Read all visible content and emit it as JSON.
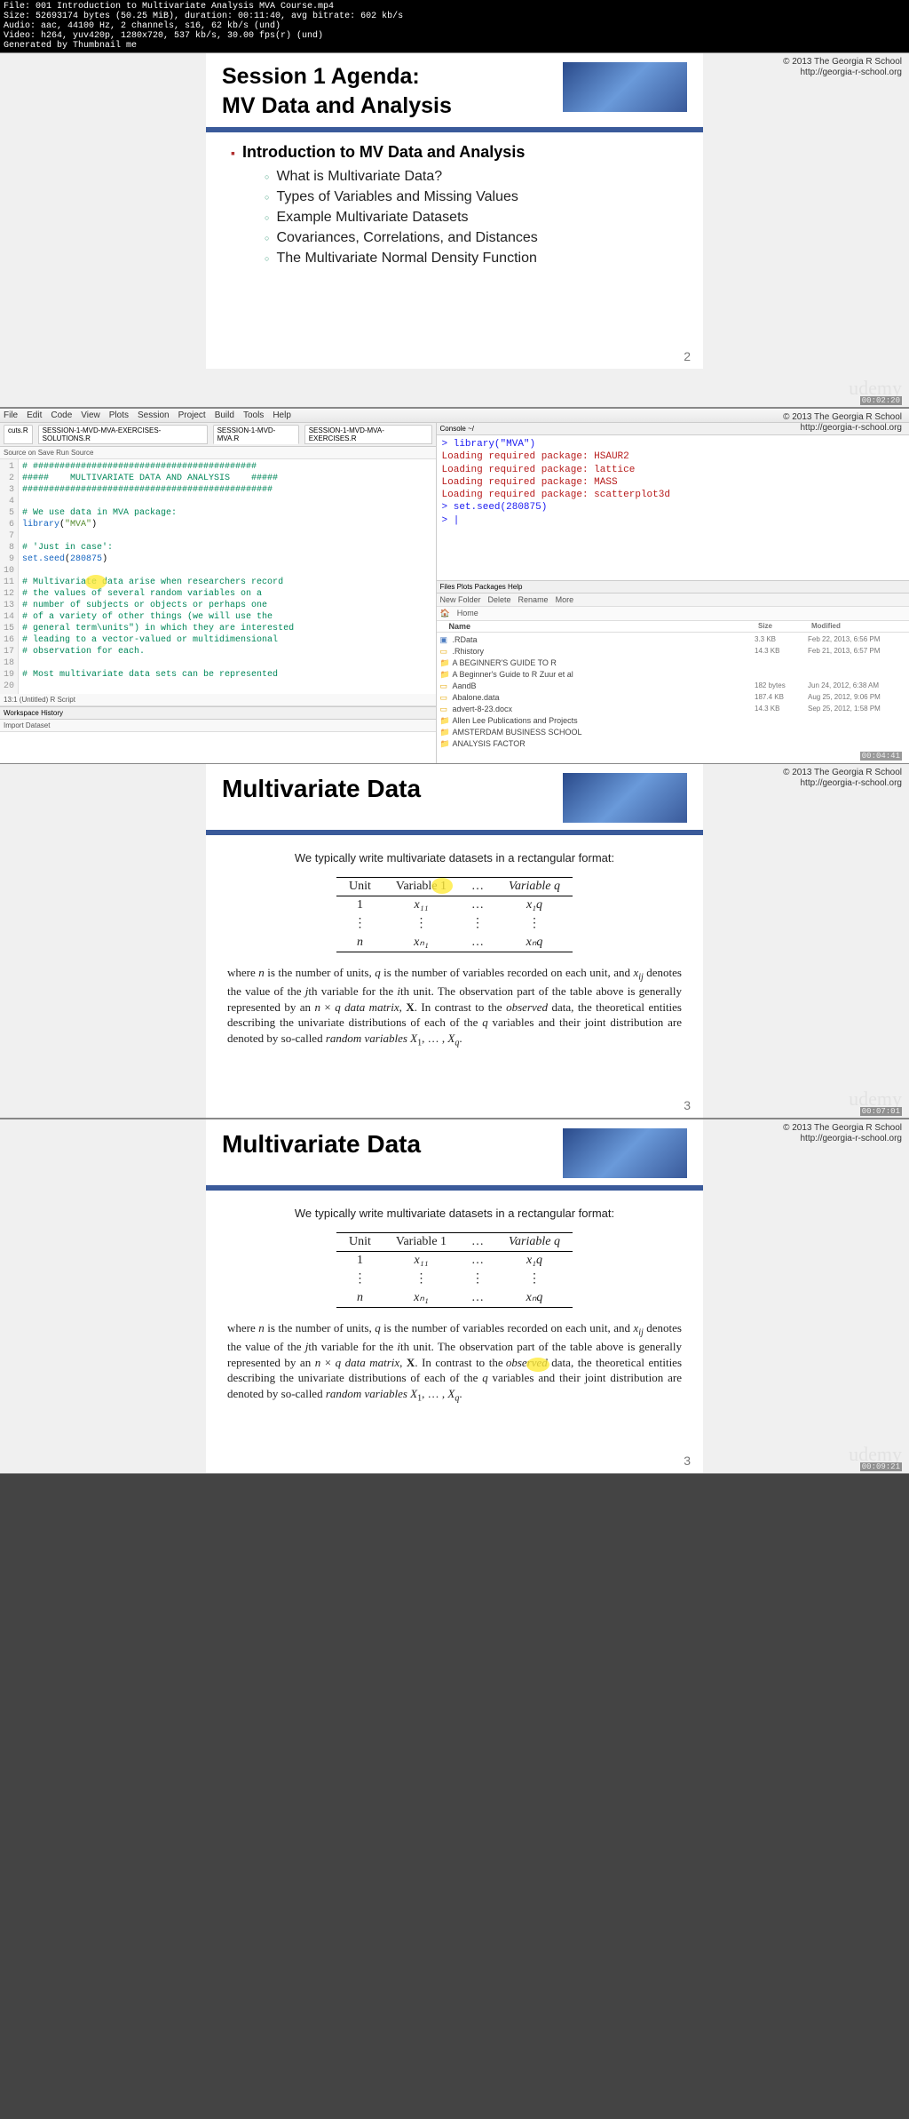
{
  "video_meta": {
    "file": "File: 001 Introduction to Multivariate Analysis MVA Course.mp4",
    "size": "Size: 52693174 bytes (50.25 MiB), duration: 00:11:40, avg bitrate: 602 kb/s",
    "audio": "Audio: aac, 44100 Hz, 2 channels, s16, 62 kb/s (und)",
    "video": "Video: h264, yuv420p, 1280x720, 537 kb/s, 30.00 fps(r) (und)",
    "gen": "Generated by Thumbnail me"
  },
  "copyright": {
    "line1": "© 2013 The Georgia R School",
    "line2": "http://georgia-r-school.org"
  },
  "slide1": {
    "title_line1": "Session 1 Agenda:",
    "title_line2": "MV Data and Analysis",
    "main_bullet": "Introduction to MV Data and Analysis",
    "items": [
      "What is Multivariate Data?",
      "Types of Variables and Missing Values",
      "Example Multivariate Datasets",
      "Covariances, Correlations, and Distances",
      "The Multivariate Normal Density Function"
    ],
    "page_num": "2"
  },
  "timestamps": {
    "t1": "00:02:20",
    "t2": "00:04:41",
    "t3": "00:07:01",
    "t4": "00:09:21"
  },
  "udemy_label": "udemy",
  "rstudio": {
    "menu": [
      "File",
      "Edit",
      "Code",
      "View",
      "Plots",
      "Session",
      "Project",
      "Build",
      "Tools",
      "Help"
    ],
    "tabs": [
      "cuts.R",
      "SESSION-1-MVD-MVA-EXERCISES-SOLUTIONS.R",
      "SESSION-1-MVD-MVA.R",
      "SESSION-1-MVD-MVA-EXERCISES.R"
    ],
    "toolbar": "   Source on Save        Run    Source",
    "code": [
      {
        "n": 1,
        "cls": "c-comment",
        "t": "# ##########################################"
      },
      {
        "n": 2,
        "cls": "c-comment",
        "t": "#####    MULTIVARIATE DATA AND ANALYSIS    #####"
      },
      {
        "n": 3,
        "cls": "c-comment",
        "t": "###############################################"
      },
      {
        "n": 4,
        "cls": "",
        "t": ""
      },
      {
        "n": 5,
        "cls": "c-comment",
        "t": "# We use data in MVA package:"
      },
      {
        "n": 6,
        "cls": "",
        "t": "library(\"MVA\")"
      },
      {
        "n": 7,
        "cls": "",
        "t": ""
      },
      {
        "n": 8,
        "cls": "c-comment",
        "t": "# 'Just in case':"
      },
      {
        "n": 9,
        "cls": "",
        "t": "set.seed(280875)"
      },
      {
        "n": 10,
        "cls": "",
        "t": ""
      },
      {
        "n": 11,
        "cls": "c-comment",
        "t": "# Multivariate data arise when researchers record"
      },
      {
        "n": 12,
        "cls": "c-comment",
        "t": "# the values of several random variables on a"
      },
      {
        "n": 13,
        "cls": "c-comment",
        "t": "# number of subjects or objects or perhaps one"
      },
      {
        "n": 14,
        "cls": "c-comment",
        "t": "# of a variety of other things (we will use the"
      },
      {
        "n": 15,
        "cls": "c-comment",
        "t": "# general term\\units\") in which they are interested"
      },
      {
        "n": 16,
        "cls": "c-comment",
        "t": "# leading to a vector-valued or multidimensional"
      },
      {
        "n": 17,
        "cls": "c-comment",
        "t": "# observation for each."
      },
      {
        "n": 18,
        "cls": "",
        "t": ""
      },
      {
        "n": 19,
        "cls": "c-comment",
        "t": "# Most multivariate data sets can be represented"
      },
      {
        "n": 20,
        "cls": "",
        "t": ""
      }
    ],
    "editor_status": "13:1   (Untitled)                                                              R Script",
    "workspace_tabs": "Workspace   History",
    "workspace_toolbar": "   Import Dataset",
    "console_heading": "Console  ~/",
    "console": [
      {
        "cls": "blue",
        "t": "> library(\"MVA\")"
      },
      {
        "cls": "red",
        "t": "Loading required package: HSAUR2"
      },
      {
        "cls": "red",
        "t": "Loading required package: lattice"
      },
      {
        "cls": "red",
        "t": "Loading required package: MASS"
      },
      {
        "cls": "red",
        "t": "Loading required package: scatterplot3d"
      },
      {
        "cls": "blue",
        "t": "> set.seed(280875)"
      },
      {
        "cls": "blue",
        "t": "> |"
      }
    ],
    "files_tabs": "Files  Plots  Packages  Help",
    "files_toolbar": [
      "New Folder",
      "Delete",
      "Rename",
      "More"
    ],
    "breadcrumb": "Home",
    "file_headers": {
      "name": "Name",
      "size": "Size",
      "mod": "Modified"
    },
    "files": [
      {
        "icon": "blue",
        "name": ".RData",
        "size": "3.3 KB",
        "date": "Feb 22, 2013, 6:56 PM"
      },
      {
        "icon": "",
        "name": ".Rhistory",
        "size": "14.3 KB",
        "date": "Feb 21, 2013, 6:57 PM"
      },
      {
        "icon": "folder",
        "name": "A BEGINNER'S GUIDE TO R",
        "size": "",
        "date": ""
      },
      {
        "icon": "folder",
        "name": "A Beginner's Guide to R Zuur et al",
        "size": "",
        "date": ""
      },
      {
        "icon": "",
        "name": "AandB",
        "size": "182 bytes",
        "date": "Jun 24, 2012, 6:38 AM"
      },
      {
        "icon": "",
        "name": "Abalone.data",
        "size": "187.4 KB",
        "date": "Aug 25, 2012, 9:06 PM"
      },
      {
        "icon": "",
        "name": "advert-8-23.docx",
        "size": "14.3 KB",
        "date": "Sep 25, 2012, 1:58 PM"
      },
      {
        "icon": "folder",
        "name": "Allen Lee Publications and Projects",
        "size": "",
        "date": ""
      },
      {
        "icon": "folder",
        "name": "AMSTERDAM BUSINESS SCHOOL",
        "size": "",
        "date": ""
      },
      {
        "icon": "folder",
        "name": "ANALYSIS FACTOR",
        "size": "",
        "date": ""
      }
    ]
  },
  "slide3": {
    "title": "Multivariate Data",
    "intro": "We typically write multivariate datasets in a rectangular format:",
    "headers": [
      "Unit",
      "Variable 1",
      "…",
      "Variable q"
    ],
    "row1": [
      "1",
      "x₁₁",
      "…",
      "x₁q"
    ],
    "rowd": [
      "⋮",
      "⋮",
      "⋮",
      "⋮"
    ],
    "rown": [
      "n",
      "xₙ₁",
      "…",
      "xₙq"
    ],
    "page_num": "3"
  }
}
